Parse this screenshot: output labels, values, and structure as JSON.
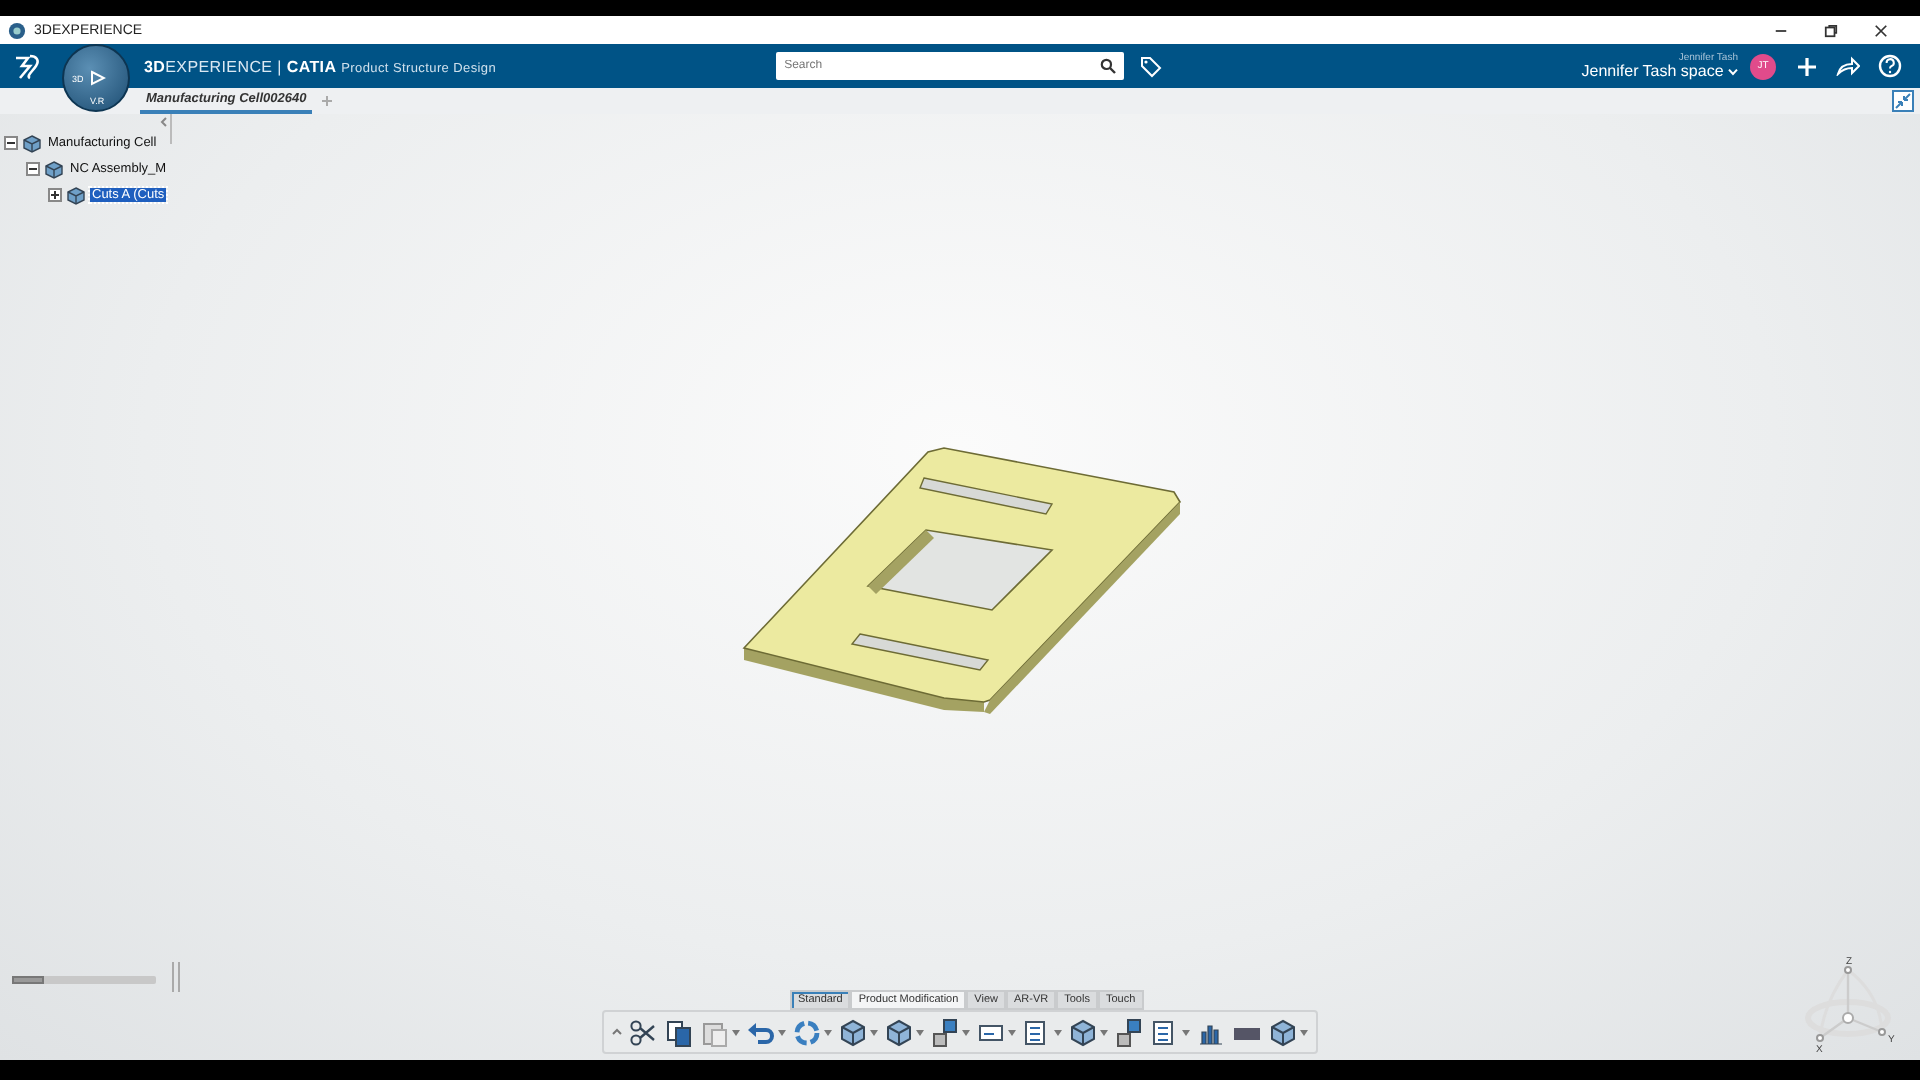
{
  "window": {
    "title": "3DEXPERIENCE"
  },
  "header": {
    "brand_bold": "3D",
    "brand_rest": "EXPERIENCE",
    "separator": "|",
    "app": "CATIA",
    "role": "Product Structure Design",
    "search": {
      "placeholder": "Search"
    },
    "user": "Jennifer Tash",
    "space": "Jennifer Tash space",
    "avatar": "JT"
  },
  "compass": {
    "labels": [
      "3D",
      "V.R"
    ]
  },
  "tabs": [
    {
      "label": "Manufacturing Cell002640",
      "selected": true
    }
  ],
  "tree": [
    {
      "label": "Manufacturing Cell",
      "expanded": true,
      "selected": false,
      "children": [
        {
          "label": "NC Assembly_M",
          "expanded": true,
          "selected": false,
          "children": [
            {
              "label": "Cuts A (Cuts",
              "expanded": false,
              "selected": true
            }
          ]
        }
      ]
    }
  ],
  "toolbar_tabs": [
    {
      "label": "Standard",
      "selected": false
    },
    {
      "label": "Product Modification",
      "selected": true
    },
    {
      "label": "View",
      "selected": false
    },
    {
      "label": "AR-VR",
      "selected": false
    },
    {
      "label": "Tools",
      "selected": false
    },
    {
      "label": "Touch",
      "selected": false
    }
  ],
  "tools": [
    {
      "kind": "cut",
      "dropdown": false
    },
    {
      "kind": "copy",
      "dropdown": false
    },
    {
      "kind": "paste",
      "dropdown": true
    },
    {
      "kind": "undo",
      "dropdown": true
    },
    {
      "kind": "update",
      "dropdown": true
    },
    {
      "kind": "cube",
      "dropdown": true
    },
    {
      "kind": "cube",
      "dropdown": true
    },
    {
      "kind": "assembly",
      "dropdown": true
    },
    {
      "kind": "box",
      "dropdown": true
    },
    {
      "kind": "list",
      "dropdown": true
    },
    {
      "kind": "cube",
      "dropdown": true
    },
    {
      "kind": "assembly",
      "dropdown": false
    },
    {
      "kind": "list",
      "dropdown": true
    },
    {
      "kind": "chart",
      "dropdown": false
    },
    {
      "kind": "bar",
      "dropdown": false
    },
    {
      "kind": "cube",
      "dropdown": true
    }
  ],
  "axes": [
    "Z",
    "Y",
    "X"
  ]
}
